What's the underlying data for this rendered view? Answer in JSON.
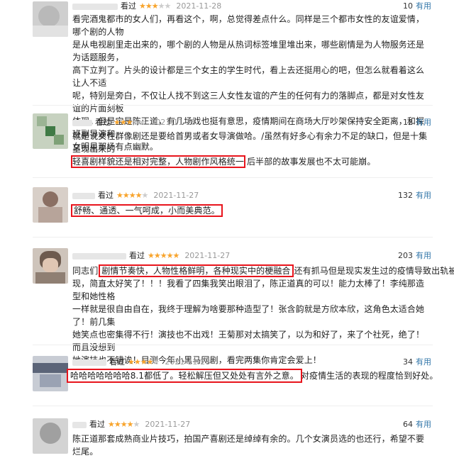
{
  "reviews": [
    {
      "watched": "看过",
      "rating": 3,
      "date": "2021-11-28",
      "votes": "10",
      "useful": "有用",
      "lines": [
        [
          "看完酒鬼都市的女人们，再看这个，啊，总觉得差点什么。同样是三个都市女性的友谊爱情，哪个剧的人物"
        ],
        [
          "是从电视剧里走出来的，哪个剧的人物是从热词标签堆里堆出来，哪些剧情是为人物服务还是为话题服务，"
        ],
        [
          "高下立判了。片头的设计都是三个女主的学生时代，看上去还挺用心的吧，但怎么就看着这么让人不适"
        ],
        [
          "呢，特别是旁白，不仅让人找不到这三人女性友谊的产生的任何有力的落脚点，都是对女性友谊的片面刻板"
        ],
        [
          "体现。但是宝是陈正道，有几场戏也挺有意思，疫情期间在商场大厅吵架保持安全距离，和探班副导演和"
        ],
        [
          "女明星那场有点幽默。"
        ]
      ]
    },
    {
      "watched": "看过",
      "rating": 3,
      "date": "2021-11-28",
      "votes": "12",
      "useful": "有用",
      "lines": [
        [
          "就是说女性群像剧还是要给首男或者女导演做哈。/虽然有好多心有余力不足的缺口，但是十集呈现出来的"
        ],
        [
          "轻喜剧样貌还是相对完整，人物剧作风格统一",
          "后半部的故事发展也不太可能崩。"
        ]
      ]
    },
    {
      "watched": "看过",
      "rating": 4,
      "date": "2021-11-27",
      "votes": "132",
      "useful": "有用",
      "lines": [
        [
          "舒畅、通透、一气呵成，小而美典范。"
        ]
      ]
    },
    {
      "watched": "看过",
      "rating": 5,
      "date": "2021-11-27",
      "votes": "203",
      "useful": "有用",
      "lines": [
        [
          "同志们",
          "剧情节奏快，人物性格鲜明，各种现实中的梗融合",
          "还有抓马但是现实发生过的疫情导致出轨被发"
        ],
        [
          "现，简直太好笑了！！！我看了四集我笑出眼泪了，陈正道真的可以！能力太棒了！李纯那造型和她性格"
        ],
        [
          "一样就是很自由自在，我终于理解为啥要那种造型了！张含韵就是方欣本欣，这角色太适合她了！前几集"
        ],
        [
          "她笑点也密集得不行！演技也不出戏！王菊那对太搞笑了，以为和好了，来了个社死，绝了！而且没想到"
        ],
        [
          "她演技也不错诶！目测今年小黑马网剧，看完两集你肯定会爱上！"
        ]
      ]
    },
    {
      "watched": "看过",
      "rating": 4,
      "date": "2021-11-28",
      "votes": "34",
      "useful": "有用",
      "lines": [
        [
          "哈哈哈哈哈哈哈8.1都低了。轻松解压但又处处有言外之意。",
          "对疫情生活的表现的程度恰到好处。"
        ]
      ]
    },
    {
      "watched": "看过",
      "rating": 4,
      "date": "2021-11-27",
      "votes": "64",
      "useful": "有用",
      "lines": [
        [
          "陈正道那套成熟商业片技巧，拍国产喜剧还是绰绰有余的。几个女演员选的也还行，希望不要烂尾。"
        ]
      ]
    }
  ]
}
